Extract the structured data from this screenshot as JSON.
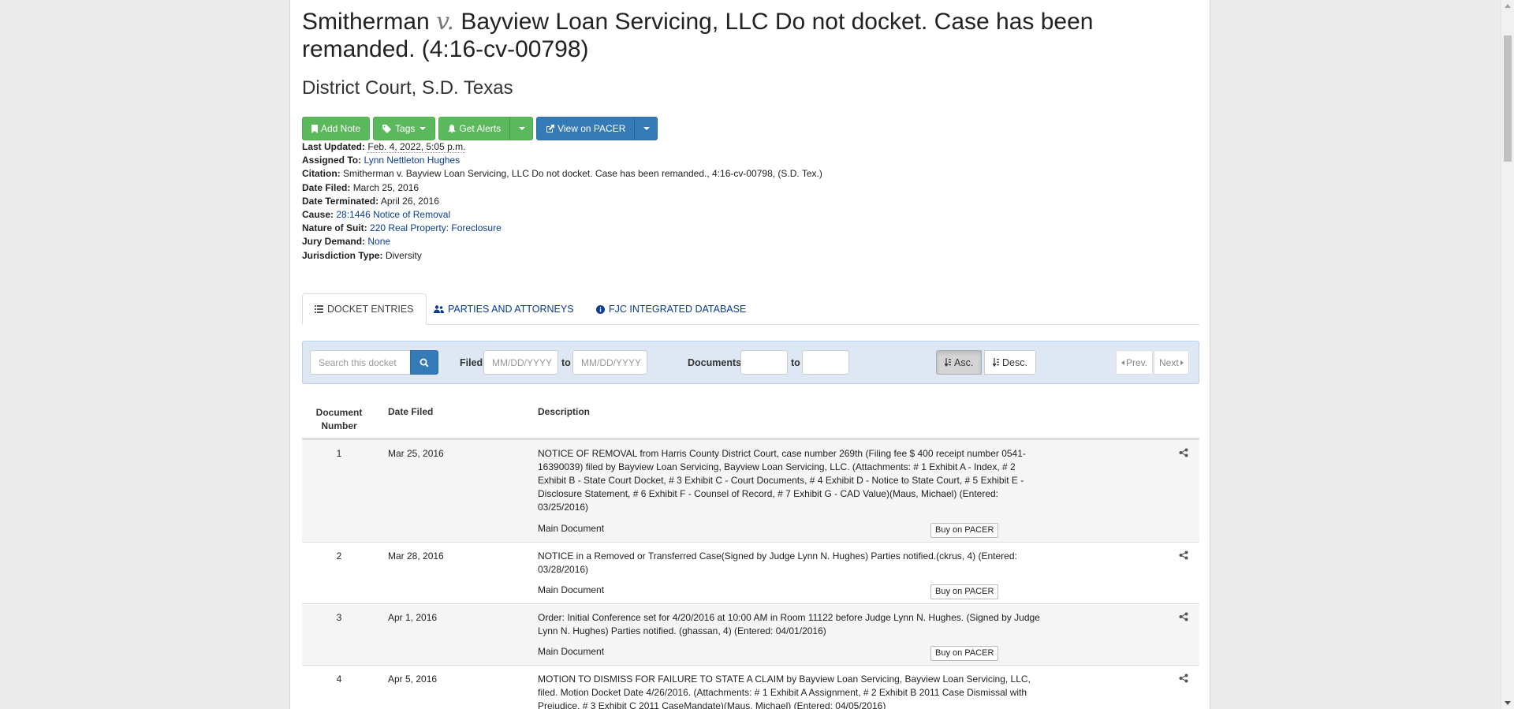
{
  "case": {
    "title_part1": "Smitherman",
    "title_v": "v.",
    "title_part2": "Bayview Loan Servicing, LLC Do not docket. Case has been remanded. (4:16-cv-00798)",
    "court": "District Court, S.D. Texas"
  },
  "toolbar": {
    "add_note": "Add Note",
    "tags": "Tags",
    "get_alerts": "Get Alerts",
    "view_on_pacer": "View on PACER"
  },
  "meta": {
    "last_updated_label": "Last Updated:",
    "last_updated": "Feb. 4, 2022, 5:05 p.m.",
    "assigned_to_label": "Assigned To:",
    "assigned_to": "Lynn Nettleton Hughes",
    "citation_label": "Citation:",
    "citation": "Smitherman v. Bayview Loan Servicing, LLC Do not docket. Case has been remanded., 4:16-cv-00798, (S.D. Tex.)",
    "date_filed_label": "Date Filed:",
    "date_filed": "March 25, 2016",
    "date_terminated_label": "Date Terminated:",
    "date_terminated": "April 26, 2016",
    "cause_label": "Cause:",
    "cause": "28:1446 Notice of Removal",
    "nature_label": "Nature of Suit:",
    "nature": "220 Real Property: Foreclosure",
    "jury_label": "Jury Demand:",
    "jury": "None",
    "jurisdiction_label": "Jurisdiction Type:",
    "jurisdiction": "Diversity"
  },
  "tabs": {
    "docket": "DOCKET ENTRIES",
    "parties": "PARTIES AND ATTORNEYS",
    "fjc": "FJC INTEGRATED DATABASE"
  },
  "filters": {
    "search_placeholder": "Search this docket",
    "filed_label": "Filed",
    "date_placeholder": "MM/DD/YYYY",
    "to_label": "to",
    "documents_label": "Documents",
    "asc": "Asc.",
    "desc": "Desc.",
    "prev": "Prev.",
    "next": "Next"
  },
  "table": {
    "col_num": "Document Number",
    "col_date": "Date Filed",
    "col_desc": "Description",
    "main_document": "Main Document",
    "buy_label": "Buy on PACER",
    "rows": [
      {
        "num": "1",
        "date": "Mar 25, 2016",
        "desc": "NOTICE OF REMOVAL from Harris County District Court, case number 269th (Filing fee $ 400 receipt number 0541-16390039) filed by Bayview Loan Servicing, Bayview Loan Servicing, LLC. (Attachments: # 1 Exhibit A - Index, # 2 Exhibit B - State Court Docket, # 3 Exhibit C - Court Documents, # 4 Exhibit D - Notice to State Court, # 5 Exhibit E - Disclosure Statement, # 6 Exhibit F - Counsel of Record, # 7 Exhibit G - CAD Value)(Maus, Michael) (Entered: 03/25/2016)"
      },
      {
        "num": "2",
        "date": "Mar 28, 2016",
        "desc": "NOTICE in a Removed or Transferred Case(Signed by Judge Lynn N. Hughes) Parties notified.(ckrus, 4) (Entered: 03/28/2016)"
      },
      {
        "num": "3",
        "date": "Apr 1, 2016",
        "desc": "Order: Initial Conference set for 4/20/2016 at 10:00 AM in Room 11122 before Judge Lynn N. Hughes. (Signed by Judge Lynn N. Hughes) Parties notified. (ghassan, 4) (Entered: 04/01/2016)"
      },
      {
        "num": "4",
        "date": "Apr 5, 2016",
        "desc": "MOTION TO DISMISS FOR FAILURE TO STATE A CLAIM by Bayview Loan Servicing, Bayview Loan Servicing, LLC, filed. Motion Docket Date 4/26/2016. (Attachments: # 1 Exhibit A Assignment, # 2 Exhibit B 2011 Case Dismissal with Prejudice, # 3 Exhibit C 2011 CaseMandate)(Maus, Michael) (Entered: 04/05/2016)"
      }
    ]
  },
  "colors": {
    "green": "#5cb85c",
    "blue": "#337ab7",
    "link": "#0b3d91",
    "filter_bg": "#dde8f4"
  }
}
